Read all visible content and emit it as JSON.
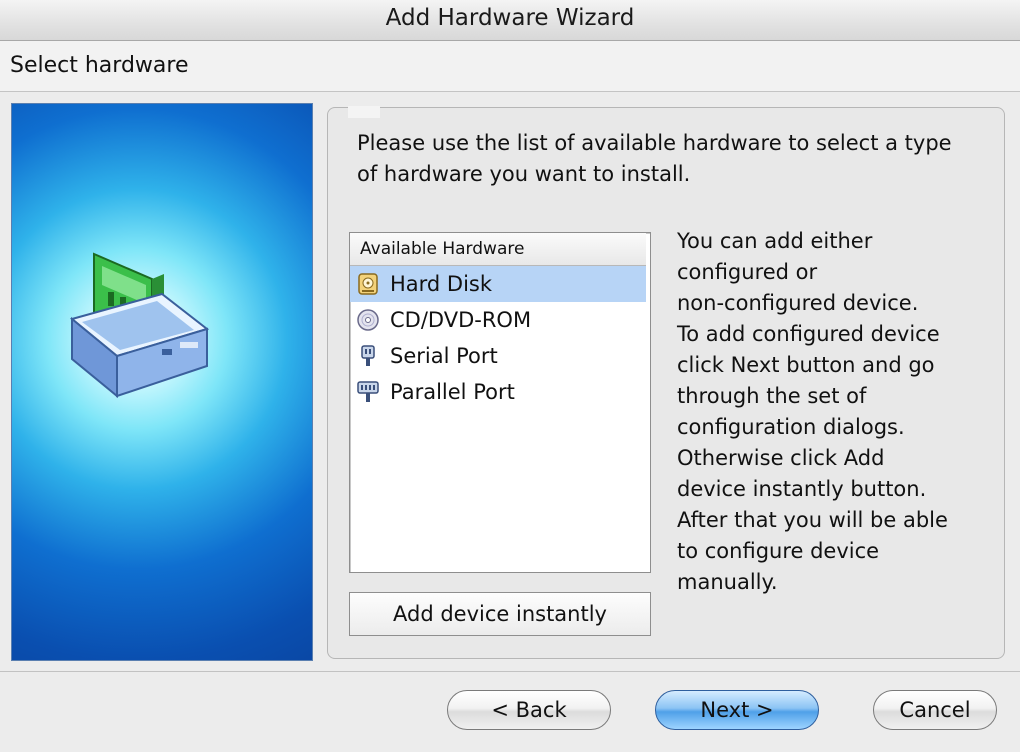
{
  "window": {
    "title": "Add Hardware Wizard"
  },
  "header": {
    "title": "Select hardware"
  },
  "intro_text": "Please use the list of available hardware to select a type of hardware you want to install.",
  "hardware_list": {
    "header": "Available Hardware",
    "items": [
      {
        "label": "Hard Disk",
        "icon": "hard-disk-icon",
        "selected": true
      },
      {
        "label": "CD/DVD-ROM",
        "icon": "cd-dvd-icon",
        "selected": false
      },
      {
        "label": "Serial Port",
        "icon": "serial-port-icon",
        "selected": false
      },
      {
        "label": "Parallel Port",
        "icon": "parallel-port-icon",
        "selected": false
      }
    ]
  },
  "add_instantly_label": "Add device instantly",
  "help_text": "You can add either\nconfigured or\nnon-configured device.\nTo add configured device\nclick Next button and go\nthrough the set of\nconfiguration dialogs.\nOtherwise click Add\ndevice instantly button.\nAfter that you will be able\nto configure device\nmanually.",
  "buttons": {
    "back": "< Back",
    "next": "Next >",
    "cancel": "Cancel"
  },
  "colors": {
    "selection": "#b7d4f6",
    "primary_button": "#4fa0e8",
    "side_image_blue": "#0f6fd0"
  }
}
